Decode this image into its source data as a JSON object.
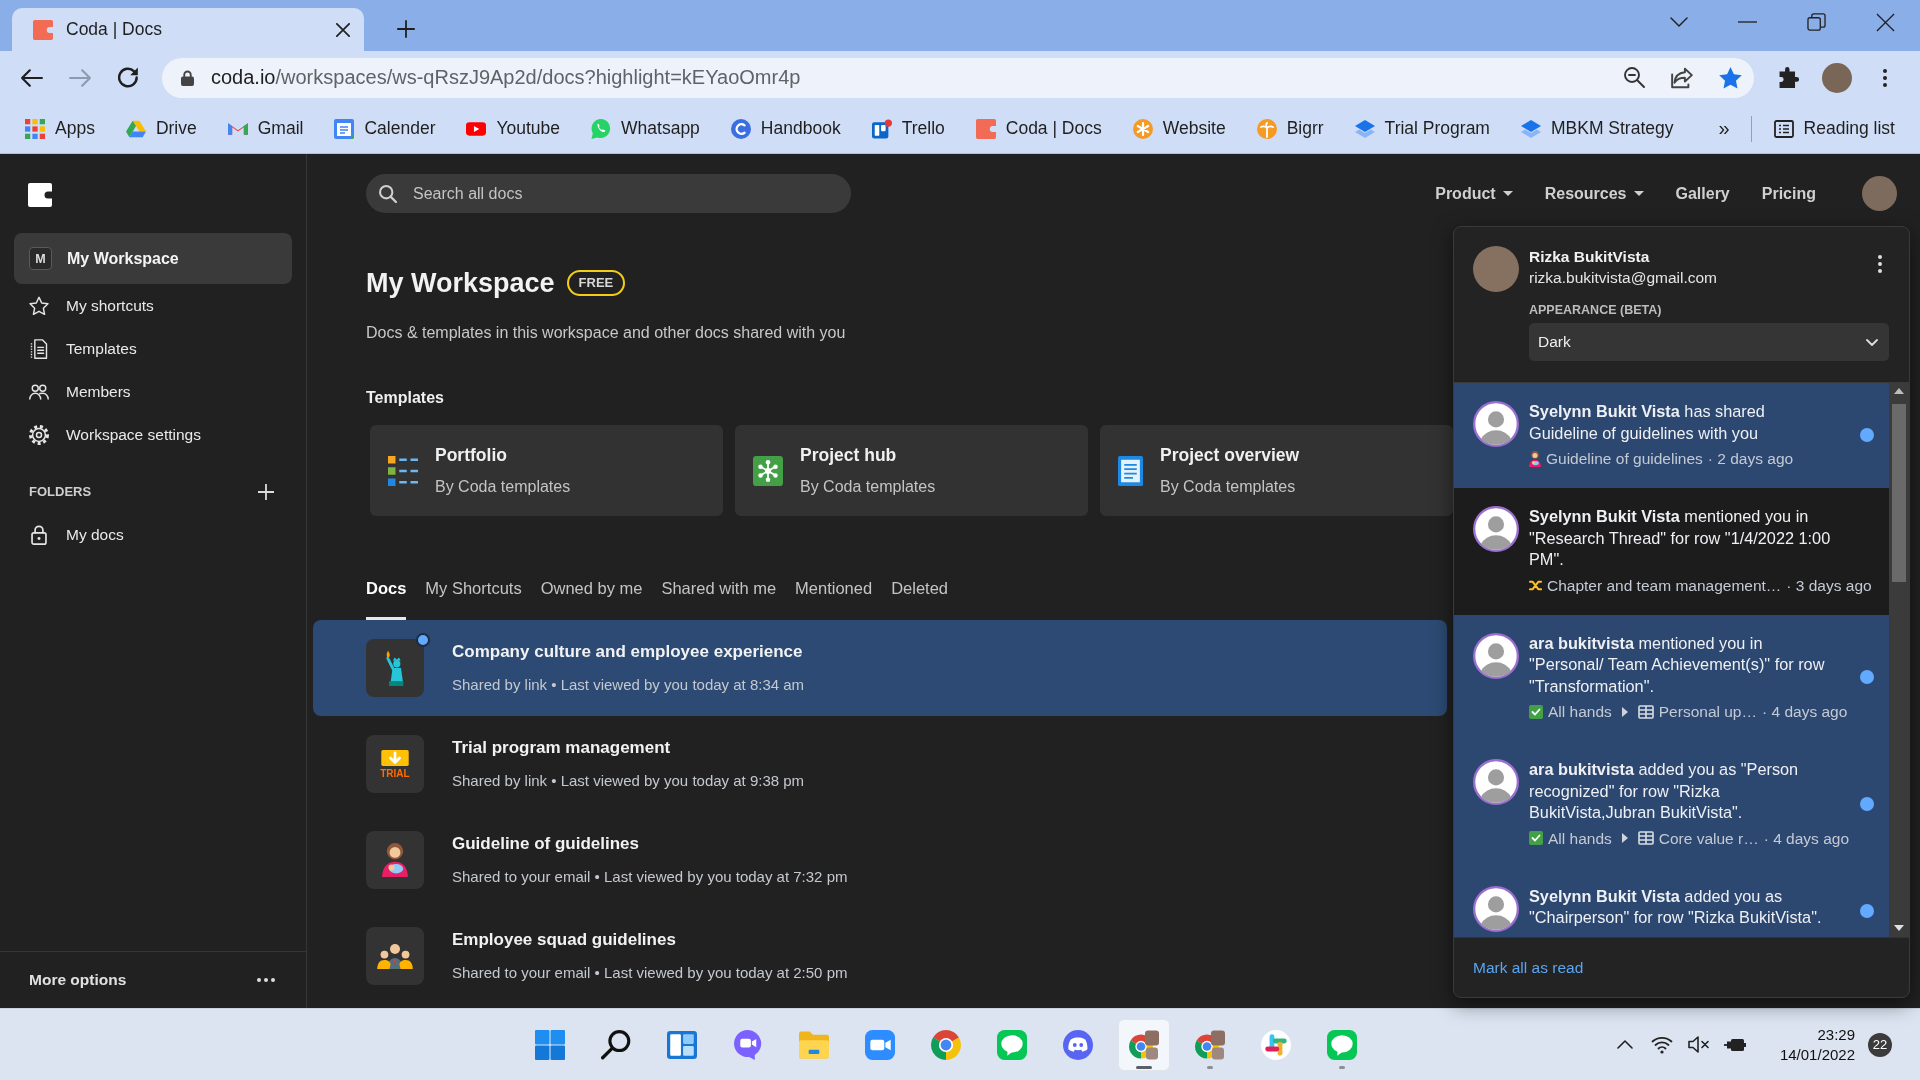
{
  "browser": {
    "tabs": [
      {
        "title": "Coda | Docs",
        "selected": true
      }
    ],
    "back_enabled": true,
    "forward_enabled": false,
    "address": {
      "host": "coda.io",
      "path": "/workspaces/ws-qRszJ9Ap2d/docs?highlight=kEYaoOmr4p",
      "bookmarked": true
    },
    "bookmarks": [
      {
        "kind": "apps",
        "label": "Apps"
      },
      {
        "kind": "drive",
        "label": "Drive"
      },
      {
        "kind": "gmail",
        "label": "Gmail"
      },
      {
        "kind": "calendar",
        "label": "Calender"
      },
      {
        "kind": "youtube",
        "label": "Youtube"
      },
      {
        "kind": "whatsapp",
        "label": "Whatsapp"
      },
      {
        "kind": "handbook",
        "label": "Handbook"
      },
      {
        "kind": "trello",
        "label": "Trello"
      },
      {
        "kind": "coda",
        "label": "Coda | Docs"
      },
      {
        "kind": "website",
        "label": "Website"
      },
      {
        "kind": "bigrr",
        "label": "Bigrr"
      },
      {
        "kind": "layers",
        "label": "Trial Program"
      },
      {
        "kind": "layers",
        "label": "MBKM Strategy"
      }
    ],
    "more_bookmarks": "»",
    "reading_list": "Reading list"
  },
  "sidebar": {
    "workspace": {
      "initial": "M",
      "label": "My Workspace",
      "selected": true
    },
    "items": [
      {
        "kind": "star",
        "label": "My shortcuts",
        "selected": false
      },
      {
        "kind": "templates",
        "label": "Templates",
        "selected": false
      },
      {
        "kind": "members",
        "label": "Members",
        "selected": false
      },
      {
        "kind": "settings",
        "label": "Workspace settings",
        "selected": false
      }
    ],
    "folders_title": "FOLDERS",
    "folders": [
      {
        "kind": "lock",
        "label": "My docs",
        "selected": false
      }
    ],
    "more_options": "More options"
  },
  "header": {
    "search": {
      "placeholder": "Search all docs"
    },
    "nav": [
      {
        "label": "Product",
        "has_menu": true
      },
      {
        "label": "Resources",
        "has_menu": true
      },
      {
        "label": "Gallery",
        "has_menu": false
      },
      {
        "label": "Pricing",
        "has_menu": false
      }
    ]
  },
  "workspace": {
    "title": "My Workspace",
    "plan": "FREE",
    "description": "Docs & templates in this workspace and other docs shared with you"
  },
  "templates": {
    "title": "Templates",
    "cards": [
      {
        "kind": "portfolio",
        "title": "Portfolio",
        "byline": "By Coda templates"
      },
      {
        "kind": "hub",
        "title": "Project hub",
        "byline": "By Coda templates"
      },
      {
        "kind": "overview",
        "title": "Project overview",
        "byline": "By Coda templates"
      }
    ]
  },
  "doc_tabs": [
    {
      "label": "Docs",
      "selected": true
    },
    {
      "label": "My Shortcuts",
      "selected": false
    },
    {
      "label": "Owned by me",
      "selected": false
    },
    {
      "label": "Shared with me",
      "selected": false
    },
    {
      "label": "Mentioned",
      "selected": false
    },
    {
      "label": "Deleted",
      "selected": false
    }
  ],
  "docs": [
    {
      "kind": "statue",
      "title": "Company culture and employee experience",
      "details": "Shared by link • Last viewed by you today at 8:34 am",
      "highlighted": true,
      "unread": true
    },
    {
      "kind": "trial",
      "icon_label": "TRIAL",
      "title": "Trial program management",
      "details": "Shared by link • Last viewed by you today at 9:38 pm",
      "highlighted": false,
      "unread": false
    },
    {
      "kind": "mother",
      "title": "Guideline of guidelines",
      "details": "Shared to your email • Last viewed by you today at 7:32 pm",
      "highlighted": false,
      "unread": false
    },
    {
      "kind": "team",
      "title": "Employee squad guidelines",
      "details": "Shared to your email • Last viewed by you today at 2:50 pm",
      "highlighted": false,
      "unread": false
    }
  ],
  "account_panel": {
    "name": "Rizka BukitVista",
    "email": "rizka.bukitvista@gmail.com",
    "appearance_label": "APPEARANCE (BETA)",
    "appearance": "Dark",
    "notifications": [
      {
        "text": "**Syelynn Bukit Vista** has shared Guideline of guidelines with you",
        "unread": true,
        "crumbs": [
          {
            "kind": "mother",
            "label": "Guideline of guidelines"
          }
        ],
        "time": "· 2 days ago"
      },
      {
        "text": "**Syelynn Bukit Vista** mentioned you in \"Research Thread\" for row \"1/4/2022 1:00 PM\".",
        "unread": false,
        "crumbs": [
          {
            "kind": "shuffle",
            "label": "Chapter and team management…"
          }
        ],
        "time": "· 3 days ago"
      },
      {
        "text": "**ara bukitvista** mentioned you in \"Personal/ Team Achievement(s)\" for row \"Transformation\".",
        "unread": true,
        "crumbs": [
          {
            "kind": "check",
            "label": "All hands"
          },
          {
            "kind": "table",
            "label": "Personal up…"
          }
        ],
        "time": "· 4 days ago"
      },
      {
        "text": "**ara bukitvista** added you as \"Person recognized\" for row \"Rizka BukitVista,Jubran BukitVista\".",
        "unread": true,
        "crumbs": [
          {
            "kind": "check",
            "label": "All hands"
          },
          {
            "kind": "table",
            "label": "Core value r…"
          }
        ],
        "time": "· 4 days ago"
      },
      {
        "text": "**Syelynn Bukit Vista** added you as \"Chairperson\" for row \"Rizka BukitVista\".",
        "unread": true
      }
    ],
    "mark_all": "Mark all as read"
  },
  "taskbar": {
    "apps": [
      {
        "kind": "start",
        "running": false,
        "selected": false
      },
      {
        "kind": "search",
        "running": false,
        "selected": false
      },
      {
        "kind": "widgets",
        "running": false,
        "selected": false
      },
      {
        "kind": "chat",
        "running": false,
        "selected": false
      },
      {
        "kind": "explorer",
        "running": false,
        "selected": false
      },
      {
        "kind": "zoom",
        "running": false,
        "selected": false
      },
      {
        "kind": "chrome",
        "running": false,
        "selected": false
      },
      {
        "kind": "line",
        "running": false,
        "selected": false
      },
      {
        "kind": "discord",
        "running": false,
        "selected": false
      },
      {
        "kind": "chrome_profile",
        "running": true,
        "selected": true
      },
      {
        "kind": "chrome_profile",
        "running": true,
        "selected": false
      },
      {
        "kind": "slack",
        "running": false,
        "selected": false
      },
      {
        "kind": "line",
        "running": true,
        "selected": false
      }
    ],
    "time": "23:29",
    "date": "14/01/2022",
    "notification_count": "22"
  }
}
